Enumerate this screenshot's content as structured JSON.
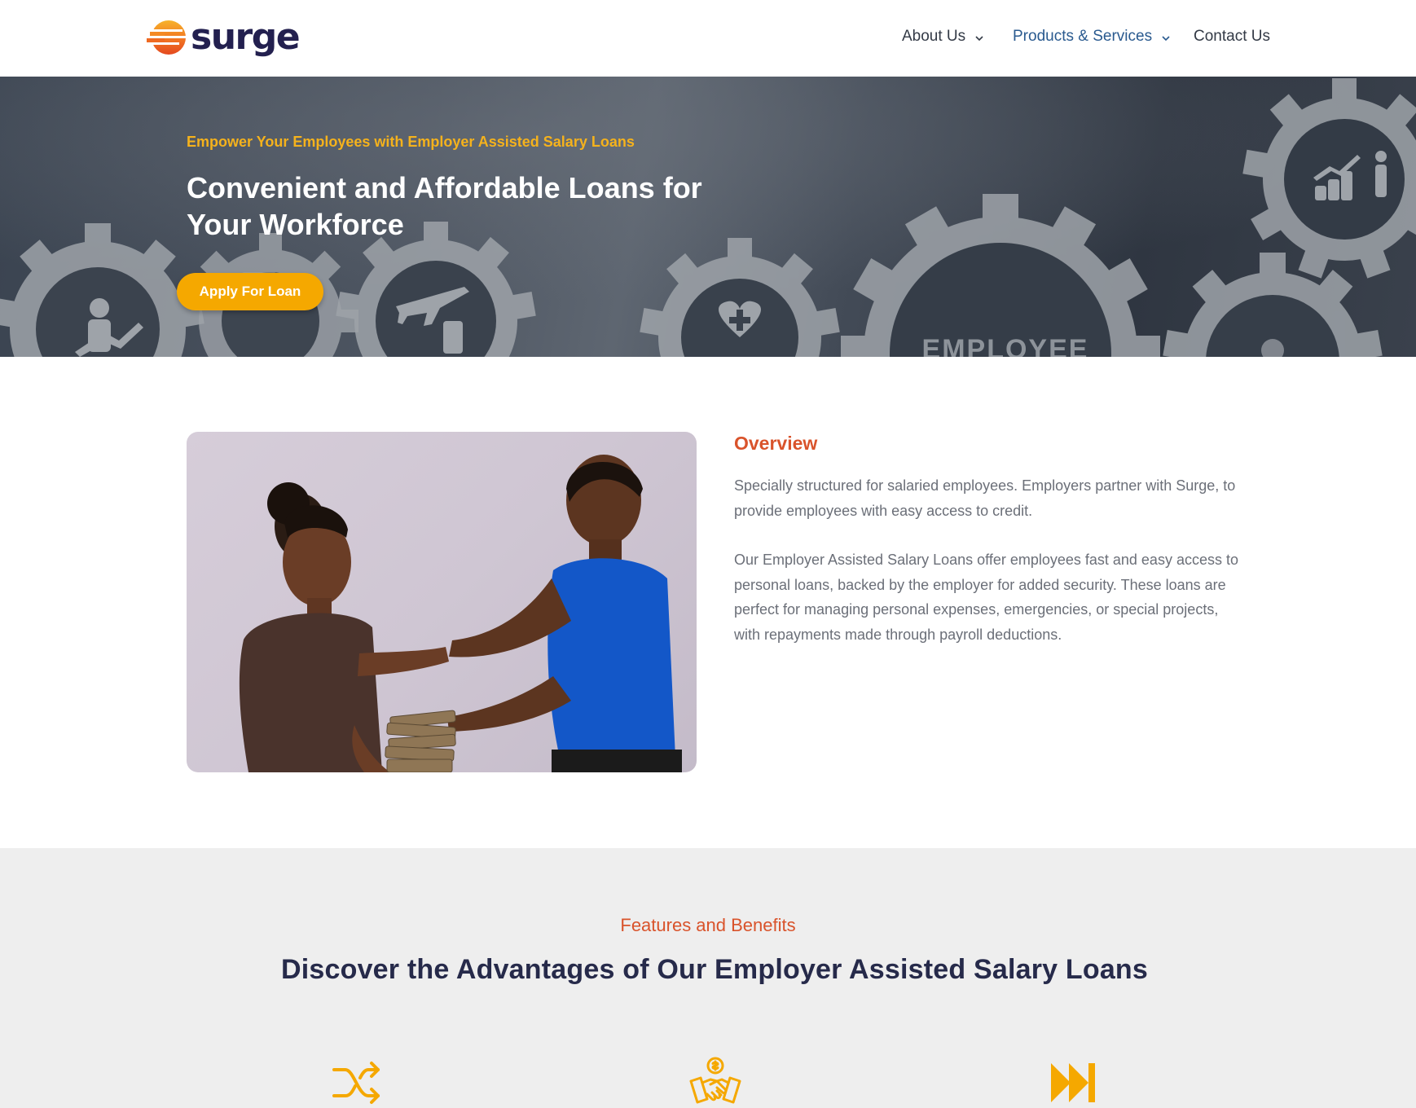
{
  "header": {
    "logo_text": "surge",
    "nav": [
      {
        "label": "About Us",
        "has_dropdown": true,
        "active": false
      },
      {
        "label": "Products & Services",
        "has_dropdown": true,
        "active": true
      },
      {
        "label": "Contact Us",
        "has_dropdown": false,
        "active": false
      }
    ]
  },
  "hero": {
    "eyebrow": "Empower Your Employees with Employer Assisted Salary Loans",
    "title": "Convenient and Affordable Loans for Your Workforce",
    "cta_label": "Apply For Loan",
    "background_word": "EMPLOYEE"
  },
  "overview": {
    "title": "Overview",
    "paragraphs": [
      "Specially structured for salaried employees. Employers partner with Surge, to provide employees with easy access to credit.",
      "Our Employer Assisted Salary Loans offer employees fast and easy access to personal loans, backed by the employer for added security. These loans are perfect for managing personal expenses, emergencies, or special projects, with repayments made through payroll deductions."
    ]
  },
  "features": {
    "eyebrow": "Features and Benefits",
    "title": "Discover the Advantages of Our Employer Assisted Salary Loans",
    "icons": [
      "shuffle-icon",
      "handshake-dollar-icon",
      "fast-forward-icon"
    ]
  },
  "colors": {
    "brand_navy": "#23204f",
    "accent_orange": "#f5a800",
    "accent_red": "#d9532b",
    "active_link": "#2a5a8f"
  }
}
